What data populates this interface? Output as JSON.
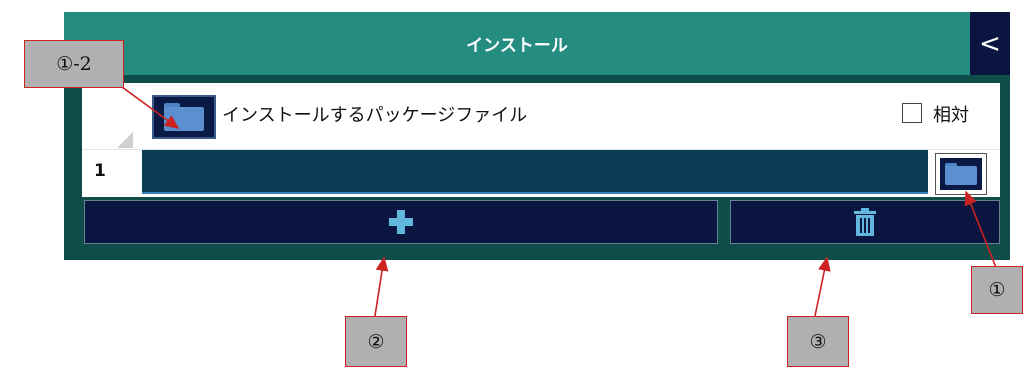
{
  "panel": {
    "title": "インストール",
    "collapse_glyph": "<",
    "header_label": "インストールするパッケージファイル",
    "relative_label": "相対",
    "relative_checked": false,
    "row_number": "1",
    "path_value": "",
    "icons": {
      "header": "folder-icon",
      "browse": "folder-icon",
      "add": "plus-icon",
      "delete": "trash-icon"
    },
    "colors": {
      "panel_bg": "#0e4d4a",
      "titlebar": "#248d80",
      "button_bg": "#0a1640",
      "icon_accent": "#62b7df"
    }
  },
  "callouts": {
    "c1_2": "①-2",
    "c1": "①",
    "c2": "②",
    "c3": "③"
  }
}
